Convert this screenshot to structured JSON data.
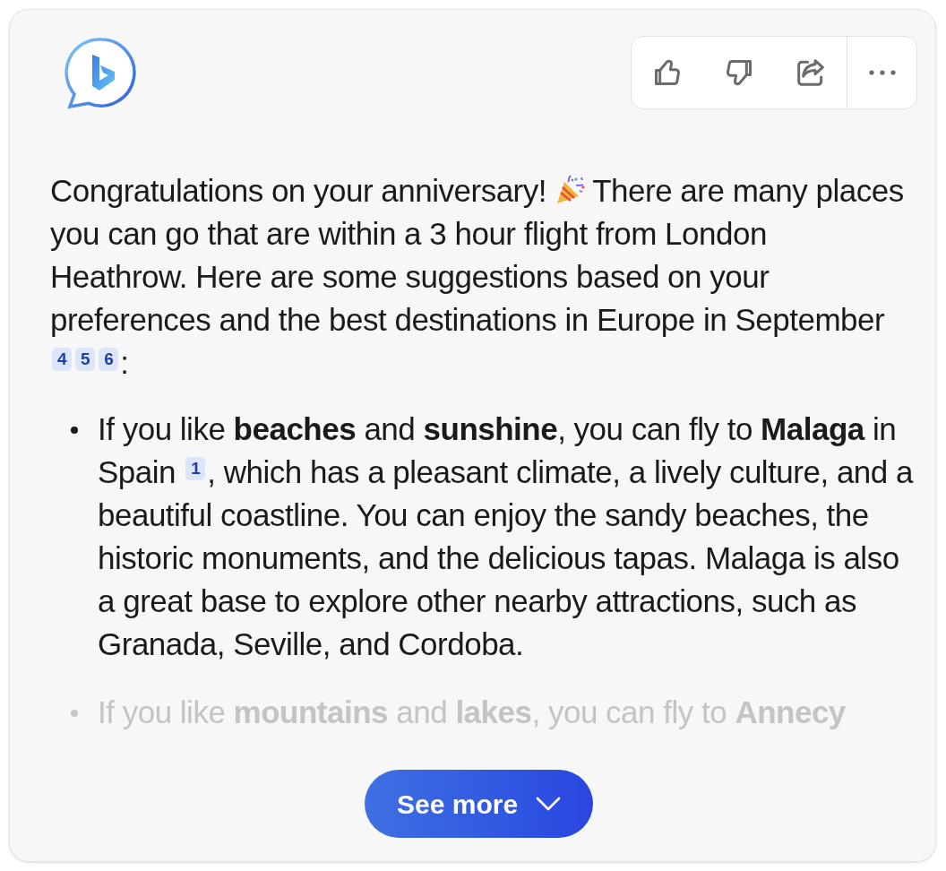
{
  "toolbar": {
    "buttons": [
      {
        "kind": "like"
      },
      {
        "kind": "dislike"
      },
      {
        "kind": "share"
      },
      {
        "kind": "more"
      }
    ]
  },
  "intro": [
    {
      "kind": "text",
      "text": "Congratulations on your anniversary!"
    },
    {
      "kind": "emoji"
    },
    {
      "kind": "text",
      "text": "There are many places you can go that are within a 3 hour flight from London Heathrow. Here are some suggestions based on your preferences and the best destinations in Europe in September"
    },
    {
      "kind": "cite",
      "text": "4"
    },
    {
      "kind": "cite",
      "text": "5"
    },
    {
      "kind": "cite",
      "text": "6"
    },
    {
      "kind": "text",
      "text": ":"
    }
  ],
  "suggestions": [
    {
      "faded": false,
      "parts": [
        {
          "kind": "text",
          "text": "If you like **beaches** and **sunshine**, you can fly to **Malaga** in Spain"
        },
        {
          "kind": "cite",
          "text": "1"
        },
        {
          "kind": "text",
          "text": ", which has a pleasant climate, a lively culture, and a beautiful coastline. You can enjoy the sandy beaches, the historic monuments, and the delicious tapas. Malaga is also a great base to explore other nearby attractions, such as Granada, Seville, and Cordoba."
        }
      ]
    },
    {
      "faded": true,
      "parts": [
        {
          "kind": "text",
          "text": "If you like **mountains** and **lakes**, you can fly to **Annecy**"
        }
      ]
    }
  ],
  "see_more": {
    "label": "See more"
  }
}
